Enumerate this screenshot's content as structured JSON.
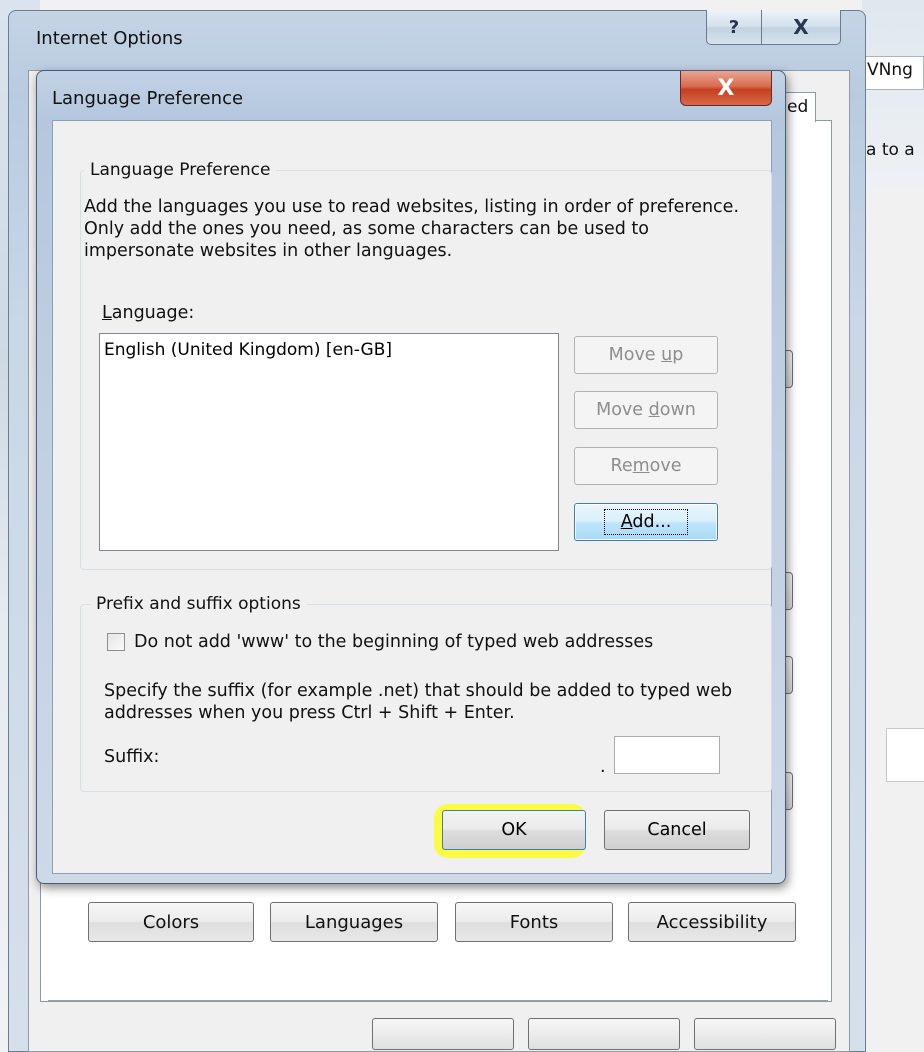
{
  "background_window": {
    "title": "Internet Options",
    "help_glyph": "?",
    "close_glyph": "X",
    "tab_partial_label": "ed",
    "right_edge_text_1": "VNng",
    "right_edge_text_2": "a to a",
    "buttons": {
      "colors": "Colors",
      "languages": "Languages",
      "fonts": "Fonts",
      "accessibility": "Accessibility"
    }
  },
  "dialog": {
    "title": "Language Preference",
    "close_glyph": "X",
    "language_group": {
      "label": "Language Preference",
      "description": "Add the languages you use to read websites, listing in order of preference. Only add the ones you need, as some characters can be used to impersonate websites in other languages.",
      "list_label_prefix": "",
      "list_label_mnemonic": "L",
      "list_label_rest": "anguage:",
      "items": [
        "English (United Kingdom) [en-GB]"
      ],
      "move_up": {
        "pre": "Move ",
        "mn": "u",
        "post": "p"
      },
      "move_down": {
        "pre": "Move ",
        "mn": "d",
        "post": "own"
      },
      "remove": {
        "pre": "Re",
        "mn": "m",
        "post": "ove"
      },
      "add": {
        "pre": "",
        "mn": "A",
        "post": "dd..."
      }
    },
    "prefix_group": {
      "label": "Prefix and suffix options",
      "checkbox_label": "Do not add 'www' to the beginning of typed web addresses",
      "checkbox_checked": false,
      "suffix_description": "Specify the suffix (for example .net) that should be added to typed web addresses when you press Ctrl + Shift + Enter.",
      "suffix_label": "Suffix:",
      "suffix_dot": ".",
      "suffix_value": ""
    },
    "ok_label": "OK",
    "cancel_label": "Cancel",
    "highlight_color": "#ffff00"
  }
}
